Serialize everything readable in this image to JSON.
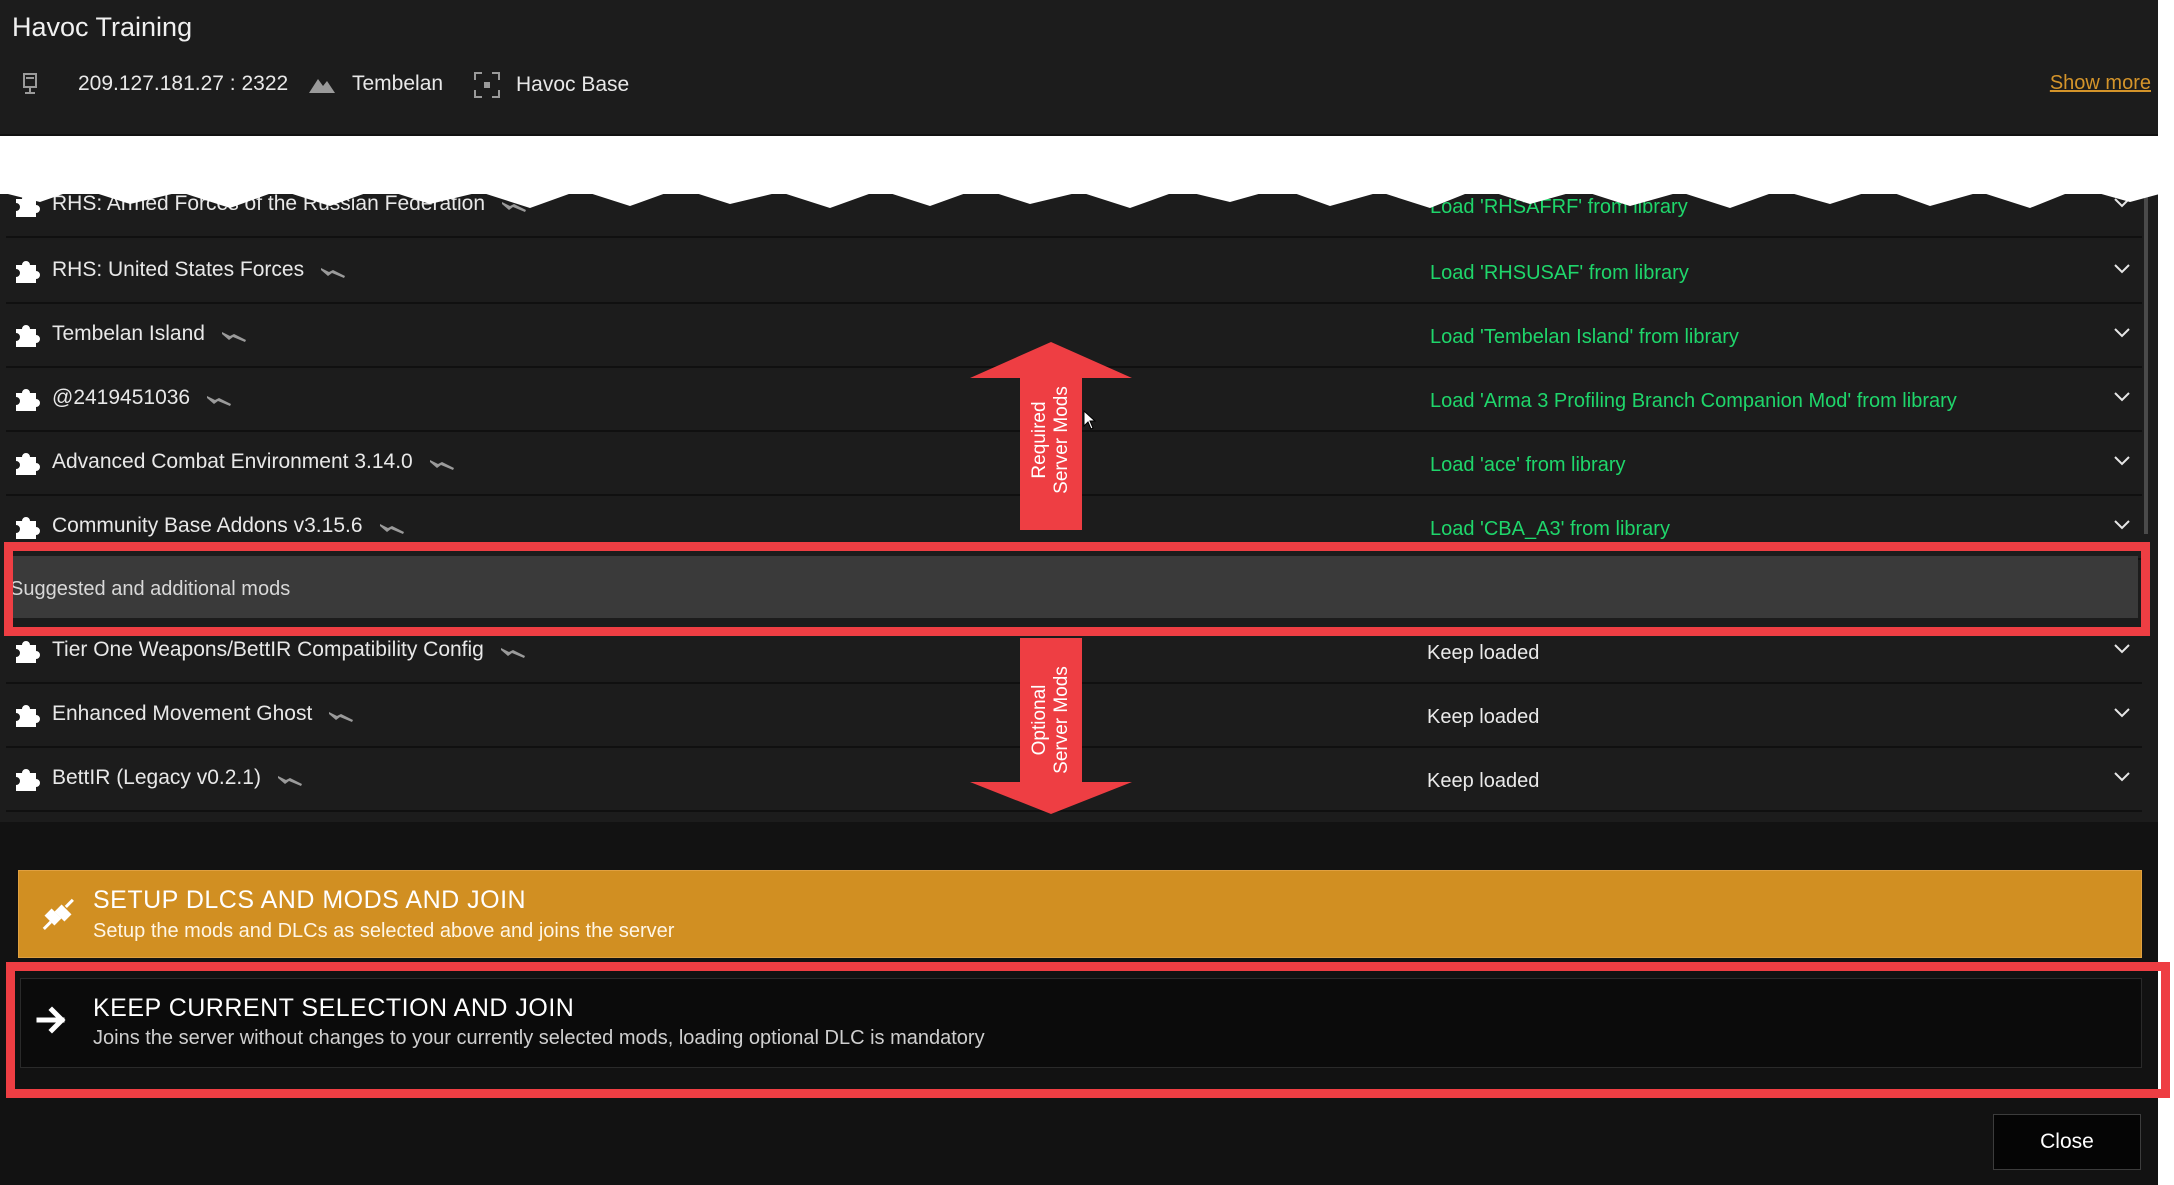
{
  "header": {
    "title": "Havoc Training",
    "address": "209.127.181.27 : 2322",
    "map": "Tembelan",
    "mission": "Havoc Base",
    "show_more": "Show more"
  },
  "required_mods": [
    {
      "name": "RHS: Armed Forces of the Russian Federation",
      "action": "Load 'RHSAFRF' from library"
    },
    {
      "name": "RHS: United States Forces",
      "action": "Load 'RHSUSAF' from library"
    },
    {
      "name": "Tembelan Island",
      "action": "Load 'Tembelan Island' from library"
    },
    {
      "name": "@2419451036",
      "action": "Load 'Arma 3 Profiling Branch Companion Mod' from library"
    },
    {
      "name": "Advanced Combat Environment 3.14.0",
      "action": "Load 'ace' from library"
    },
    {
      "name": "Community Base Addons v3.15.6",
      "action": "Load 'CBA_A3' from library"
    }
  ],
  "section_header": "Suggested and additional mods",
  "optional_mods": [
    {
      "name": "Tier One Weapons/BettIR Compatibility Config",
      "action": "Keep loaded"
    },
    {
      "name": "Enhanced Movement Ghost",
      "action": "Keep loaded"
    },
    {
      "name": "BettIR (Legacy v0.2.1)",
      "action": "Keep loaded"
    }
  ],
  "annotations": {
    "required_label_line1": "Required",
    "required_label_line2": "Server Mods",
    "optional_label_line1": "Optional",
    "optional_label_line2": "Server Mods"
  },
  "buttons": {
    "setup_title": "SETUP DLCS AND MODS AND JOIN",
    "setup_subtitle": "Setup the mods and DLCs as selected above and joins the server",
    "keep_title": "KEEP CURRENT SELECTION AND JOIN",
    "keep_subtitle": "Joins the server without changes to your currently selected mods, loading optional DLC is mandatory",
    "close": "Close"
  },
  "colors": {
    "background": "#1c1c1c",
    "accent_orange": "#d18f22",
    "load_green": "#1fd66b",
    "annotation_red": "#ee3e43"
  },
  "icons": [
    "server-icon",
    "terrain-icon",
    "frame-icon",
    "puzzle-icon",
    "wrench-icon",
    "chevron-down-icon",
    "plug-icon",
    "arrow-right-icon"
  ]
}
